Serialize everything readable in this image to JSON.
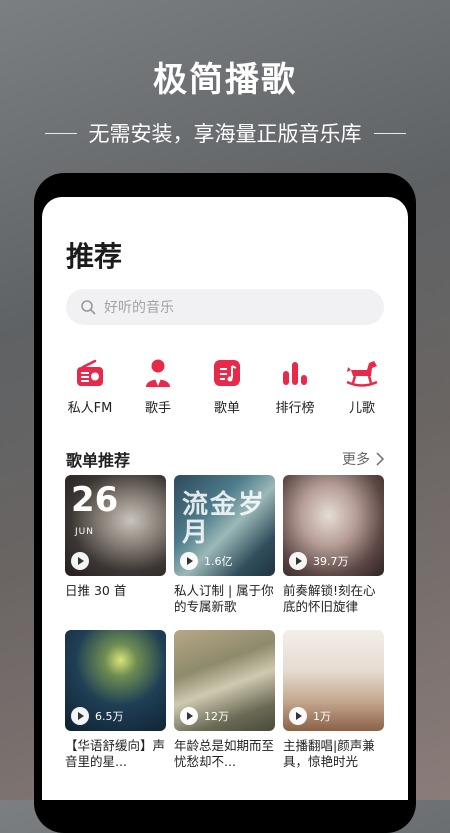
{
  "promo": {
    "title": "极简播歌",
    "subtitle": "无需安装，享海量正版音乐库"
  },
  "screen": {
    "page_title": "推荐",
    "search": {
      "placeholder": "好听的音乐"
    },
    "categories": [
      {
        "label": "私人FM",
        "icon": "radio-icon"
      },
      {
        "label": "歌手",
        "icon": "singer-icon"
      },
      {
        "label": "歌单",
        "icon": "playlist-icon"
      },
      {
        "label": "排行榜",
        "icon": "chart-icon"
      },
      {
        "label": "儿歌",
        "icon": "rocking-horse-icon"
      }
    ],
    "section": {
      "title": "歌单推荐",
      "more": "更多"
    },
    "playlists": [
      {
        "title": "日推 30 首",
        "count": "",
        "date_day": "26",
        "date_month": "JUN"
      },
      {
        "title": "私人订制 | 属于你的专属新歌",
        "count": "1.6亿",
        "cover_text": "流金岁月"
      },
      {
        "title": "前奏解锁!刻在心底的怀旧旋律",
        "count": "39.7万"
      },
      {
        "title": "【华语舒缓向】声音里的星...",
        "count": "6.5万"
      },
      {
        "title": "年龄总是如期而至忧愁却不...",
        "count": "12万"
      },
      {
        "title": "主播翻唱|颜声兼具，惊艳时光",
        "count": "1万"
      }
    ]
  },
  "colors": {
    "accent": "#e8294a",
    "background": "#ffffff"
  }
}
